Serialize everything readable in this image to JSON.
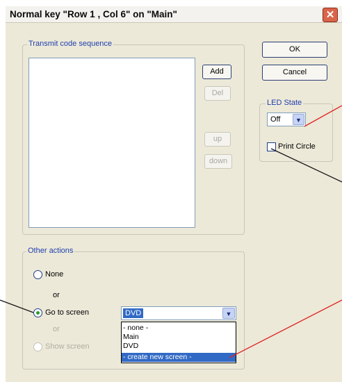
{
  "window": {
    "title": "Normal key \"Row 1 , Col 6\" on \"Main\"",
    "close_glyph": "✕"
  },
  "transmit": {
    "group_label": "Transmit code sequence",
    "add_label": "Add",
    "del_label": "Del",
    "up_label": "up",
    "down_label": "down"
  },
  "buttons": {
    "ok_label": "OK",
    "cancel_label": "Cancel"
  },
  "led": {
    "group_label": "LED State",
    "value": "Off",
    "print_circle_label": "Print Circle",
    "print_circle_checked": false
  },
  "other_actions": {
    "group_label": "Other actions",
    "none_label": "None",
    "or_label_1": "or",
    "goto_label": "Go to screen",
    "or_label_2": "or",
    "show_label": "Show screen",
    "selected": "goto",
    "screen_combo_value": "DVD",
    "dropdown_options": [
      "- none -",
      "Main",
      "DVD",
      "- create new screen -"
    ],
    "dropdown_highlighted_index": 3
  },
  "colors": {
    "group_label": "#1f3fae",
    "selection": "#316ac5",
    "annotation": "#e02424"
  }
}
